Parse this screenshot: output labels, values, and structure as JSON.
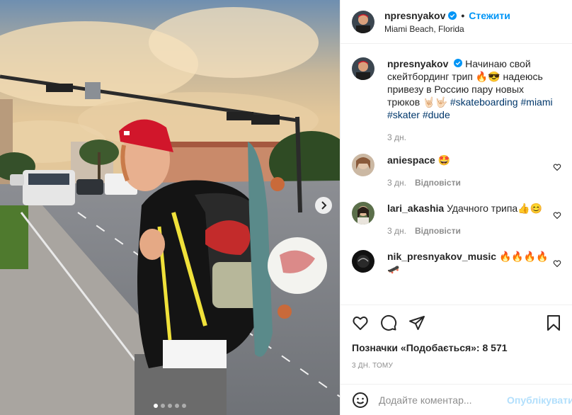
{
  "post": {
    "username": "npresnyakov",
    "follow_label": "Стежити",
    "location": "Miami Beach, Florida",
    "separator": "•",
    "carousel": {
      "slides": 5,
      "active": 1
    }
  },
  "caption": {
    "username": "npresnyakov",
    "text_1": "Начинаю свой скейтбординг трип 🔥😎 надеюсь привезу в Россию пару новых трюков 🤘🏻🤟🏻",
    "tags": [
      "#skateboarding",
      "#miami",
      "#skater",
      "#dude"
    ],
    "age": "3 дн."
  },
  "comments": [
    {
      "username": "aniespace",
      "text": "🤩",
      "age": "3 дн.",
      "reply": "Відповісти"
    },
    {
      "username": "lari_akashia",
      "text": "Удачного трипа👍😊",
      "age": "3 дн.",
      "reply": "Відповісти"
    },
    {
      "username": "nik_presnyakov_music",
      "text": "🔥🔥🔥🔥🛹",
      "age": "",
      "reply": ""
    }
  ],
  "actions": {
    "likes_label": "Позначки «Подобається»: 8 571",
    "date_label": "3 ДН. ТОМУ"
  },
  "comment_box": {
    "placeholder": "Додайте коментар...",
    "publish_label": "Опублікувати"
  },
  "colors": {
    "link_blue": "#0095f6",
    "publish_disabled": "#b2dffc",
    "hashtag": "#00376b",
    "muted": "#8e8e8e"
  },
  "icons": [
    "verified-icon",
    "heart-icon",
    "comment-icon",
    "share-icon",
    "bookmark-icon",
    "emoji-icon",
    "chevron-right-icon"
  ]
}
